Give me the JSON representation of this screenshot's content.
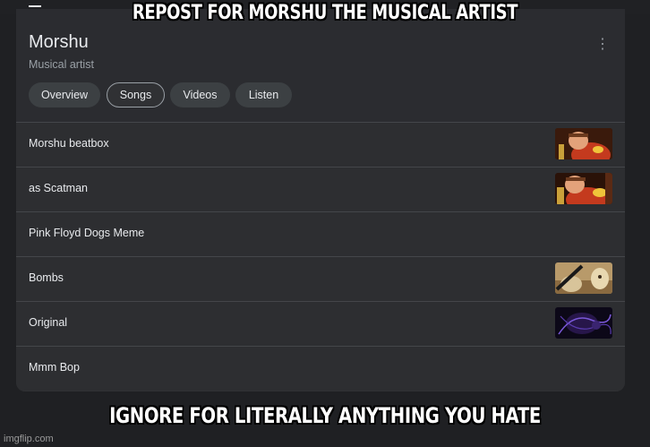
{
  "meme": {
    "top_caption": "REPOST FOR MORSHU THE MUSICAL ARTIST",
    "bottom_caption": "IGNORE FOR LITERALLY ANYTHING YOU HATE",
    "watermark": "imgflip.com"
  },
  "panel": {
    "title": "Morshu",
    "subtitle": "Musical artist",
    "menu_icon": "more-vert-icon",
    "tabs": [
      {
        "label": "Overview",
        "selected": false
      },
      {
        "label": "Songs",
        "selected": true
      },
      {
        "label": "Videos",
        "selected": false
      },
      {
        "label": "Listen",
        "selected": false
      }
    ],
    "songs": [
      {
        "title": "Morshu beatbox",
        "thumbnail": "morshu-thumbnail"
      },
      {
        "title": "as Scatman",
        "thumbnail": "morshu-thumbnail"
      },
      {
        "title": "Pink Floyd Dogs Meme",
        "thumbnail": ""
      },
      {
        "title": "Bombs",
        "thumbnail": "bombs-thumbnail"
      },
      {
        "title": "Original",
        "thumbnail": "dark-purple-thumbnail"
      },
      {
        "title": "Mmm Bop",
        "thumbnail": ""
      }
    ]
  },
  "colors": {
    "page_bg": "#1f2023",
    "card_bg": "#303134",
    "chip_bg": "#3c4043",
    "text_primary": "#e8eaed",
    "text_secondary": "#9aa0a6"
  }
}
